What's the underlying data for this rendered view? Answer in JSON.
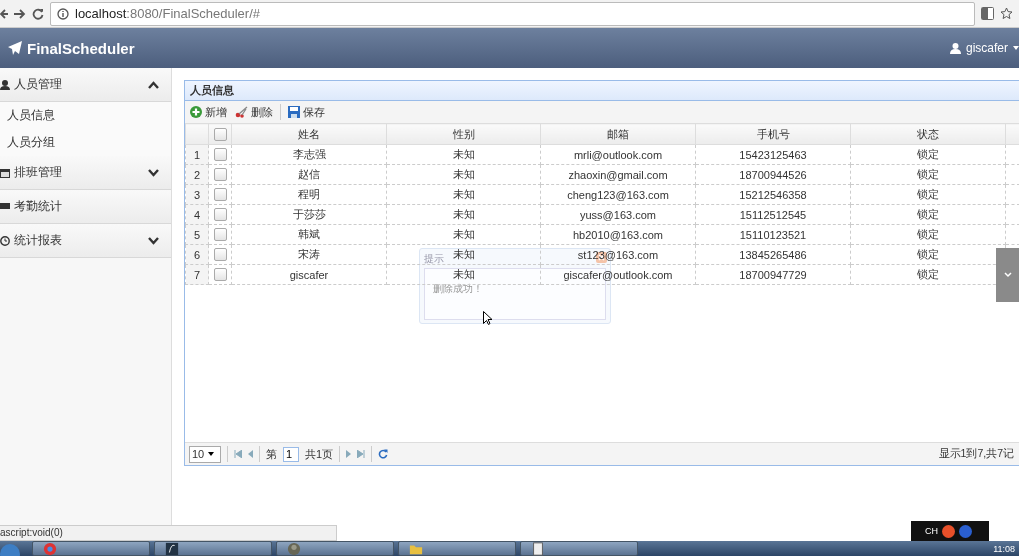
{
  "browser": {
    "url_host": "localhost",
    "url_rest": ":8080/FinalScheduler/#"
  },
  "header": {
    "brand": "FinalScheduler",
    "user": "giscafer"
  },
  "sidebar": [
    {
      "kind": "group",
      "label": "人员管理",
      "expanded": true,
      "children": [
        {
          "label": "人员信息"
        },
        {
          "label": "人员分组"
        }
      ]
    },
    {
      "kind": "group",
      "label": "排班管理",
      "expanded": false
    },
    {
      "kind": "link",
      "label": "考勤统计"
    },
    {
      "kind": "group",
      "label": "统计报表",
      "expanded": false
    }
  ],
  "panel": {
    "title": "人员信息",
    "toolbar": [
      {
        "kind": "add",
        "label": "新增"
      },
      {
        "kind": "delete",
        "label": "删除"
      },
      {
        "kind": "save",
        "label": "保存"
      }
    ],
    "header_checked": false,
    "columns": [
      "姓名",
      "性别",
      "邮箱",
      "手机号",
      "状态"
    ],
    "rows": [
      {
        "num": "1",
        "checked": false,
        "cells": [
          "李志强",
          "未知",
          "mrli@outlook.com",
          "15423125463",
          "锁定"
        ]
      },
      {
        "num": "2",
        "checked": false,
        "cells": [
          "赵信",
          "未知",
          "zhaoxin@gmail.com",
          "18700944526",
          "锁定"
        ]
      },
      {
        "num": "3",
        "checked": false,
        "cells": [
          "程明",
          "未知",
          "cheng123@163.com",
          "15212546358",
          "锁定"
        ]
      },
      {
        "num": "4",
        "checked": false,
        "cells": [
          "于莎莎",
          "未知",
          "yuss@163.com",
          "15112512545",
          "锁定"
        ]
      },
      {
        "num": "5",
        "checked": false,
        "cells": [
          "韩斌",
          "未知",
          "hb2010@163.com",
          "15110123521",
          "锁定"
        ]
      },
      {
        "num": "6",
        "checked": false,
        "cells": [
          "宋涛",
          "未知",
          "st123@163.com",
          "13845265486",
          "锁定"
        ]
      },
      {
        "num": "7",
        "checked": false,
        "cells": [
          "giscafer",
          "未知",
          "giscafer@outlook.com",
          "18700947729",
          "锁定"
        ]
      }
    ],
    "pager": {
      "page_size": "10",
      "page_prefix": "第",
      "page": "1",
      "page_suffix": "共1页",
      "info": "显示1到7,共7记"
    }
  },
  "dialog": {
    "title": "提示",
    "message": "删除成功！"
  },
  "status_text": "ascript:void(0)",
  "ime": {
    "label": "CH"
  },
  "taskbar": {
    "tasks": [
      {
        "kind": "browser"
      },
      {
        "kind": "editor"
      },
      {
        "kind": "avatar"
      },
      {
        "kind": "folder"
      },
      {
        "kind": "document"
      }
    ],
    "clock": "11:08"
  }
}
